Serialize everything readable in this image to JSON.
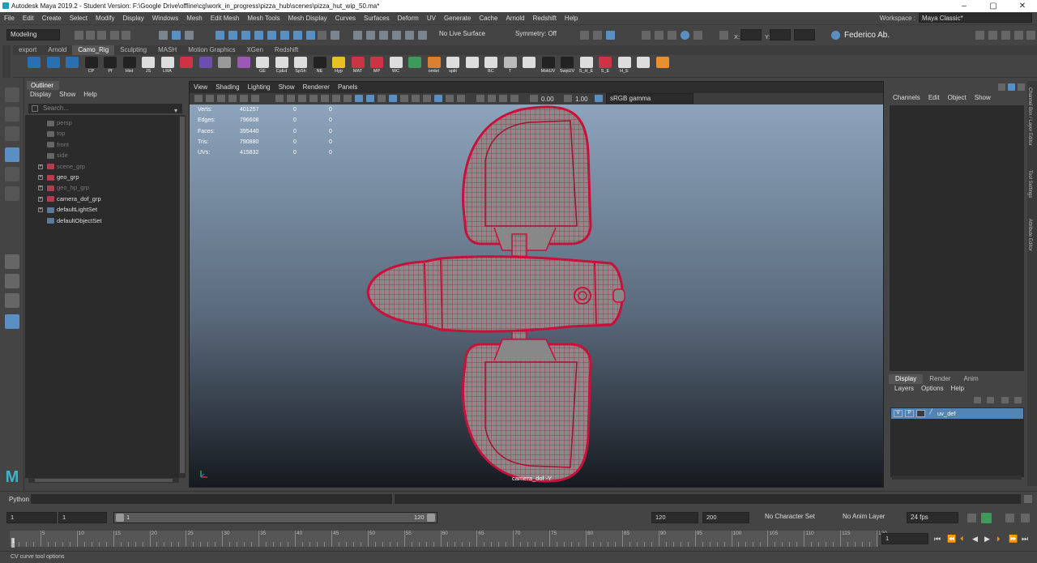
{
  "title_bar": {
    "title": "Autodesk Maya 2019.2 - Student Version: F:\\Google Drive\\offline\\cg\\work_in_progress\\pizza_hub\\scenes\\pizza_hut_wip_50.ma*",
    "minimize": "–",
    "maximize": "▢",
    "close": "✕"
  },
  "menu_bar": [
    "File",
    "Edit",
    "Create",
    "Select",
    "Modify",
    "Display",
    "Windows",
    "Mesh",
    "Edit Mesh",
    "Mesh Tools",
    "Mesh Display",
    "Curves",
    "Surfaces",
    "Deform",
    "UV",
    "Generate",
    "Cache",
    "Arnold",
    "Redshift",
    "Help"
  ],
  "workspace": {
    "label": "Workspace :",
    "value": "Maya Classic*"
  },
  "status_line": {
    "menu_set": "Modeling",
    "live_surface": "No Live Surface",
    "symmetry": "Symmetry: Off",
    "x_label": "X:",
    "y_label": "Y:",
    "z_label": "Z:",
    "user": "Federico Ab."
  },
  "shelf_tabs": [
    "export",
    "Arnold",
    "Camo_Rig",
    "Sculpting",
    "MASH",
    "Motion Graphics",
    "XGen",
    "Redshift"
  ],
  "shelf_tab_active": "Camo_Rig",
  "shelf_items": [
    {
      "label": "",
      "icon": "circle-tool-icon",
      "color": "#2a6fb0"
    },
    {
      "label": "",
      "icon": "arc-tool-icon",
      "color": "#2a6fb0"
    },
    {
      "label": "",
      "icon": "curve-tool-icon",
      "color": "#2a6fb0"
    },
    {
      "label": "CP",
      "icon": "cp-icon",
      "color": "#222222"
    },
    {
      "label": "Pf",
      "icon": "pf-icon",
      "color": "#222222"
    },
    {
      "label": "Hist",
      "icon": "hist-icon",
      "color": "#222222"
    },
    {
      "label": "JS",
      "icon": "js-icon",
      "color": "#dddddd"
    },
    {
      "label": "LRA",
      "icon": "lra-icon",
      "color": "#dddddd"
    },
    {
      "label": "",
      "icon": "skin-icon",
      "color": "#cc3344"
    },
    {
      "label": "",
      "icon": "joint-icon",
      "color": "#6a4fb0"
    },
    {
      "label": "",
      "icon": "ik-icon",
      "color": "#999999"
    },
    {
      "label": "",
      "icon": "cluster-icon",
      "color": "#9b59b6"
    },
    {
      "label": "GE",
      "icon": "ge-icon",
      "color": "#dddddd"
    },
    {
      "label": "CpEd",
      "icon": "cped-icon",
      "color": "#dddddd"
    },
    {
      "label": "SpSh",
      "icon": "spsh-icon",
      "color": "#dddddd"
    },
    {
      "label": "NE",
      "icon": "ne-icon",
      "color": "#222222"
    },
    {
      "label": "Hyp",
      "icon": "hyp-icon",
      "color": "#e8c020"
    },
    {
      "label": "MAT",
      "icon": "mat-icon",
      "color": "#cc3344"
    },
    {
      "label": "MP",
      "icon": "mp-icon",
      "color": "#cc3344"
    },
    {
      "label": "WC",
      "icon": "wc-icon",
      "color": "#dddddd"
    },
    {
      "label": "",
      "icon": "green-brush-icon",
      "color": "#3a9b5a"
    },
    {
      "label": "ombri",
      "icon": "ombri-icon",
      "color": "#d88030"
    },
    {
      "label": "split",
      "icon": "split-icon",
      "color": "#dddddd"
    },
    {
      "label": "",
      "icon": "paint-icon",
      "color": "#dddddd"
    },
    {
      "label": "BC",
      "icon": "bc-icon",
      "color": "#dddddd"
    },
    {
      "label": "T",
      "icon": "text-tool-icon",
      "color": "#bbbbbb"
    },
    {
      "label": "",
      "icon": "ball-icon",
      "color": "#dddddd"
    },
    {
      "label": "MskUV",
      "icon": "mskuv-icon",
      "color": "#222222"
    },
    {
      "label": "SwpUV",
      "icon": "swpuv-icon",
      "color": "#222222"
    },
    {
      "label": "S_H_E",
      "icon": "she-icon",
      "color": "#dddddd"
    },
    {
      "label": "S_E",
      "icon": "se-icon",
      "color": "#cc3344"
    },
    {
      "label": "H_E",
      "icon": "he-icon",
      "color": "#dddddd"
    },
    {
      "label": "",
      "icon": "box-icon",
      "color": "#dddddd"
    },
    {
      "label": "",
      "icon": "arrows-icon",
      "color": "#e89030"
    }
  ],
  "outliner": {
    "title": "Outliner",
    "menu": [
      "Display",
      "Show",
      "Help"
    ],
    "search_placeholder": "Search...",
    "items": [
      {
        "name": "persp",
        "icon": "camera-icon",
        "dim": true,
        "expandable": false
      },
      {
        "name": "top",
        "icon": "camera-icon",
        "dim": true,
        "expandable": false
      },
      {
        "name": "front",
        "icon": "camera-icon",
        "dim": true,
        "expandable": false
      },
      {
        "name": "side",
        "icon": "camera-icon",
        "dim": true,
        "expandable": false
      },
      {
        "name": "scene_grp",
        "icon": "group-icon",
        "dim": true,
        "expandable": true
      },
      {
        "name": "geo_grp",
        "icon": "group-icon",
        "dim": false,
        "expandable": true
      },
      {
        "name": "geo_hp_grp",
        "icon": "group-icon",
        "dim": true,
        "expandable": true
      },
      {
        "name": "camera_dof_grp",
        "icon": "group-icon",
        "dim": false,
        "expandable": true
      },
      {
        "name": "defaultLightSet",
        "icon": "set-icon",
        "dim": false,
        "expandable": true
      },
      {
        "name": "defaultObjectSet",
        "icon": "set-icon",
        "dim": false,
        "expandable": false
      }
    ]
  },
  "viewport": {
    "menu": [
      "View",
      "Shading",
      "Lighting",
      "Show",
      "Renderer",
      "Panels"
    ],
    "exposure": "0.00",
    "gamma": "1.00",
    "color_space": "sRGB gamma",
    "camera_label": "camera_dof -Y",
    "hud": [
      {
        "label": "Verts:",
        "a": "401257",
        "b": "0",
        "c": "0"
      },
      {
        "label": "Edges:",
        "a": "796608",
        "b": "0",
        "c": "0"
      },
      {
        "label": "Faces:",
        "a": "395440",
        "b": "0",
        "c": "0"
      },
      {
        "label": "Tris:",
        "a": "790880",
        "b": "0",
        "c": "0"
      },
      {
        "label": "UVs:",
        "a": "415832",
        "b": "0",
        "c": "0"
      }
    ],
    "wire_color": "#c8103a",
    "mesh_color": "#8a8a8a"
  },
  "channel_box": {
    "menu": [
      "Channels",
      "Edit",
      "Object",
      "Show"
    ],
    "side_tabs": [
      "Channel Box / Layer Editor",
      "Tool Settings",
      "Attribute Editor"
    ]
  },
  "layer_editor": {
    "tabs": [
      "Display",
      "Render",
      "Anim"
    ],
    "menu": [
      "Layers",
      "Options",
      "Help"
    ],
    "layer": {
      "v": "V",
      "p": "P",
      "name": "uv_def"
    }
  },
  "python_label": "Python",
  "range": {
    "start": "1",
    "playback_start": "1",
    "slider_start": "1",
    "slider_end": "120",
    "playback_end": "120",
    "end": "200",
    "character_set": "No Character Set",
    "anim_layer": "No Anim Layer",
    "fps": "24 fps"
  },
  "timeline": {
    "labels": [
      "5",
      "10",
      "15",
      "20",
      "25",
      "30",
      "35",
      "40",
      "45",
      "50",
      "55",
      "60",
      "65",
      "70",
      "75",
      "80",
      "85",
      "90",
      "95",
      "100",
      "105",
      "110",
      "115",
      "120"
    ],
    "current_frame": "1",
    "current_frame_marker": "1"
  },
  "help_line": "CV curve tool options"
}
